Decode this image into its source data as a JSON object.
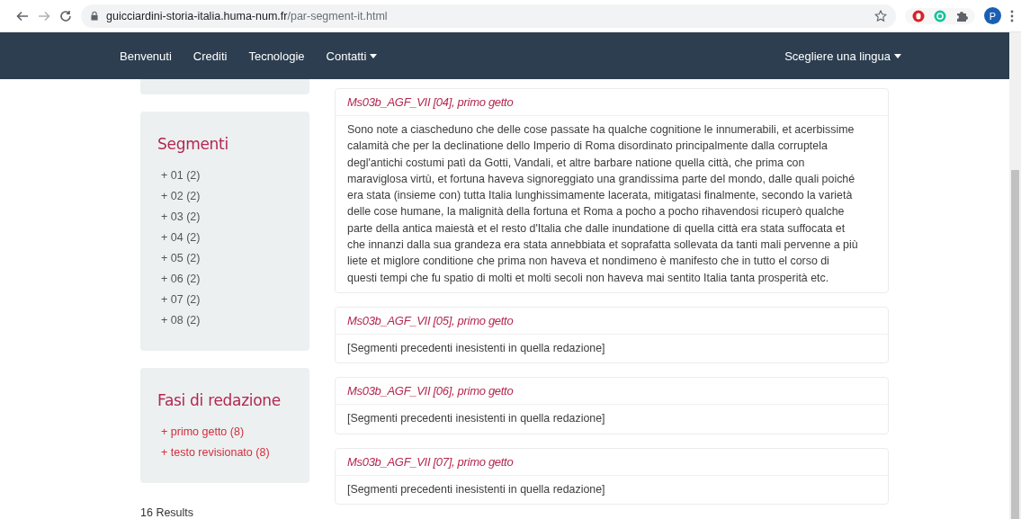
{
  "browser": {
    "url_host": "guicciardini-storia-italia.huma-num.fr",
    "url_path": "/par-segment-it.html",
    "profile": "P"
  },
  "nav": {
    "items": [
      {
        "label": "Benvenuti",
        "dropdown": false
      },
      {
        "label": "Crediti",
        "dropdown": false
      },
      {
        "label": "Tecnologie",
        "dropdown": false
      },
      {
        "label": "Contatti",
        "dropdown": true
      }
    ],
    "language": {
      "label": "Scegliere una lingua",
      "dropdown": true
    }
  },
  "sidebar": {
    "panels": [
      {
        "kind": "stub"
      },
      {
        "kind": "neutral",
        "title": "Segmenti",
        "items": [
          "+ 01 (2)",
          "+ 02 (2)",
          "+ 03 (2)",
          "+ 04 (2)",
          "+ 05 (2)",
          "+ 06 (2)",
          "+ 07 (2)",
          "+ 08 (2)"
        ]
      },
      {
        "kind": "accent",
        "title": "Fasi di redazione",
        "items": [
          "+ primo getto (8)",
          "+ testo revisionato (8)"
        ]
      }
    ],
    "results": "16 Results"
  },
  "cards": [
    {
      "title": "Ms03b_AGF_VII [04], primo getto",
      "body": "Sono note a ciascheduno che delle cose passate ha qualche cognitione le innumerabili, et acerbissime calamità che per la declinatione dello Imperio di Roma disordinato principalmente dalla corruptela degl'antichi costumi patì da Gotti, Vandali, et altre barbare natione quella città, che prima con maraviglosa virtù, et fortuna haveva signoreggiato una grandissima parte del mondo, dalle quali poiché era stata (insieme con) tutta Italia lunghissimamente lacerata, mitigatasi finalmente, secondo la varietà delle cose humane, la malignità della fortuna et Roma a pocho a pocho rihavendosi ricuperò qualche parte della antica maiestà et el resto d'Italia che dalle inundatione di quella città era stata suffocata et che innanzi dalla sua grandeza era stata annebbiata et soprafatta sollevata da tanti mali pervenne a più liete et miglore conditione che prima non haveva et nondimeno è manifesto che in tutto el corso di questi tempi che fu spatio di molti et molti secoli non haveva mai sentito Italia tanta prosperità etc."
    },
    {
      "title": "Ms03b_AGF_VII [05], primo getto",
      "body": "[Segmenti precedenti inesistenti in quella redazione]"
    },
    {
      "title": "Ms03b_AGF_VII [06], primo getto",
      "body": "[Segmenti precedenti inesistenti in quella redazione]"
    },
    {
      "title": "Ms03b_AGF_VII [07], primo getto",
      "body": "[Segmenti precedenti inesistenti in quella redazione]"
    }
  ]
}
